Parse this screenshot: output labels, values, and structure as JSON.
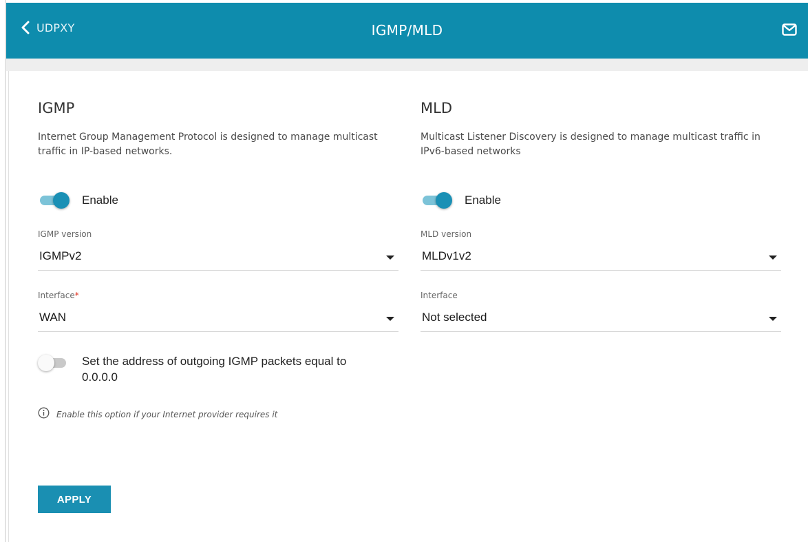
{
  "header": {
    "back_label": "UDPXY",
    "title": "IGMP/MLD"
  },
  "igmp": {
    "title": "IGMP",
    "description": "Internet Group Management Protocol is designed to manage multicast traffic in IP-based networks.",
    "enable_label": "Enable",
    "enabled": true,
    "version_label": "IGMP version",
    "version_value": "IGMPv2",
    "interface_label": "Interface",
    "interface_required_mark": "*",
    "interface_value": "WAN",
    "zero_addr_label": "Set the address of outgoing IGMP packets equal to 0.0.0.0",
    "zero_addr_enabled": false,
    "hint": "Enable this option if your Internet provider requires it"
  },
  "mld": {
    "title": "MLD",
    "description": "Multicast Listener Discovery is designed to manage multicast traffic in IPv6-based networks",
    "enable_label": "Enable",
    "enabled": true,
    "version_label": "MLD version",
    "version_value": "MLDv1v2",
    "interface_label": "Interface",
    "interface_value": "Not selected"
  },
  "actions": {
    "apply_label": "APPLY"
  },
  "colors": {
    "header_bg": "#0e8cad",
    "accent": "#1a8fb2",
    "required": "#e0301e"
  },
  "icons": {
    "back": "chevron-left-icon",
    "mail": "envelope-icon",
    "hint": "info-circle-icon"
  }
}
